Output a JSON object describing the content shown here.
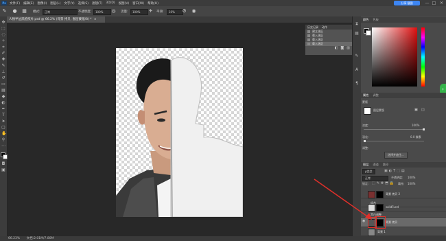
{
  "menubar": {
    "logo": "Ps",
    "items": [
      "文件(F)",
      "编辑(E)",
      "图像(I)",
      "图层(L)",
      "文字(Y)",
      "选择(S)",
      "滤镜(T)",
      "3D(D)",
      "视图(V)",
      "窗口(W)",
      "帮助(H)"
    ],
    "badge": "分享 截图",
    "window_controls": [
      "—",
      "□",
      "✕"
    ]
  },
  "options": {
    "mode_label": "模式:",
    "mode_value": "正常",
    "opacity_label": "不透明度:",
    "opacity_value": "100%",
    "flow_label": "流量:",
    "flow_value": "100%",
    "smooth_label": "平滑:",
    "smooth_value": "10%"
  },
  "document": {
    "tab_title": "人物半边黑脸照片.psd @ 66.2% (背景 拷贝, 图层蒙版/8) *",
    "tab_close": "×"
  },
  "history": {
    "tabs": [
      "历史记录",
      "动作"
    ],
    "items": [
      {
        "label": "建立选区",
        "selected": false
      },
      {
        "label": "载入选区",
        "selected": false
      },
      {
        "label": "载入选区",
        "selected": false
      },
      {
        "label": "载入选区",
        "selected": true
      }
    ]
  },
  "color_panel": {
    "tabs": [
      "颜色",
      "色板"
    ],
    "foreground": "#000000",
    "background": "#ffffff"
  },
  "properties": {
    "tabs": [
      "属性",
      "调整"
    ],
    "title": "蒙版",
    "mask_label": "图层蒙版",
    "density_label": "浓度:",
    "density_value": "100%",
    "feather_label": "羽化:",
    "feather_value": "0.0 像素",
    "refine_label": "调整:",
    "select_mask_button": "选择并遮住..."
  },
  "layers_panel": {
    "tabs": [
      "图层",
      "通道",
      "路径"
    ],
    "kind_label": "ρ类型",
    "blend_mode": "正常",
    "opacity_label": "不透明度:",
    "opacity_value": "100%",
    "lock_label": "锁定:",
    "fill_label": "填充:",
    "fill_value": "100%",
    "layers": [
      {
        "name": "背景 拷贝 2",
        "visible": false,
        "selected": false
      },
      {
        "name": "组合",
        "visible": false,
        "selected": false
      },
      {
        "name": "solidFund",
        "visible": false,
        "selected": false
      },
      {
        "name": "黑白调整",
        "visible": false,
        "selected": false
      },
      {
        "name": "背景 拷贝",
        "visible": true,
        "selected": true
      },
      {
        "name": "背景 1",
        "visible": false,
        "selected": false
      }
    ]
  },
  "statusbar": {
    "zoom": "66.23%",
    "doc_info": "文档:2.01M/7.80M"
  },
  "accent_colors": {
    "highlight": "#e0302a",
    "badge": "#3d86f4",
    "green_button": "#35b34a"
  }
}
